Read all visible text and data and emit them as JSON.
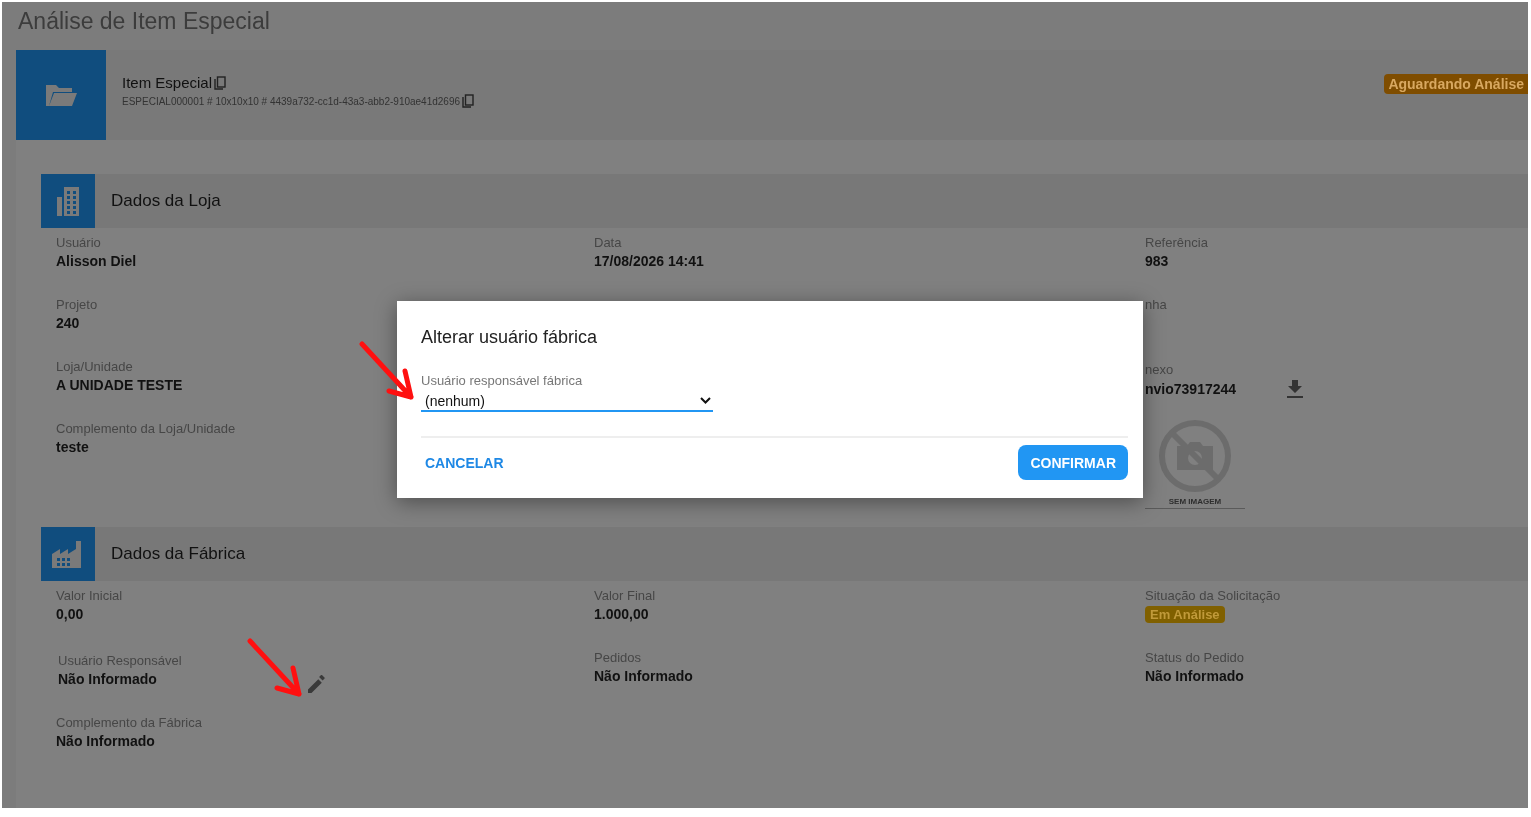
{
  "page": {
    "title": "Análise de Item Especial"
  },
  "item": {
    "title": "Item Especial",
    "code": "ESPECIAL000001 # 10x10x10 # 4439a732-cc1d-43a3-abb2-910ae41d2696",
    "status": "Aguardando Análise"
  },
  "sections": [
    {
      "kind": "store",
      "title": "Dados da Loja",
      "columns": [
        [
          {
            "kind": "text",
            "label": "Usuário",
            "value": "Alisson Diel"
          },
          {
            "kind": "text",
            "label": "Projeto",
            "value": "240"
          },
          {
            "kind": "text",
            "label": "Loja/Unidade",
            "value": "A UNIDADE TESTE"
          },
          {
            "kind": "text",
            "label": "Complemento da Loja/Unidade",
            "value": "teste"
          }
        ],
        [
          {
            "kind": "text",
            "label": "Data",
            "value": "17/08/2026 14:41"
          }
        ],
        [
          {
            "kind": "text",
            "label": "Referência",
            "value": "983"
          },
          {
            "kind": "text",
            "label": "nha"
          },
          {
            "kind": "attachment",
            "label": "nexo",
            "value": "nvio73917244"
          },
          {
            "kind": "image",
            "caption": "SEM IMAGEM"
          }
        ]
      ]
    },
    {
      "kind": "factory",
      "title": "Dados da Fábrica",
      "columns": [
        [
          {
            "kind": "text",
            "label": "Valor Inicial",
            "value": "0,00"
          },
          {
            "kind": "editable",
            "label": "Usuário Responsável",
            "value": "Não Informado"
          },
          {
            "kind": "text",
            "label": "Complemento da Fábrica",
            "value": "Não Informado"
          }
        ],
        [
          {
            "kind": "text",
            "label": "Valor Final",
            "value": "1.000,00"
          },
          {
            "kind": "text",
            "label": "Pedidos",
            "value": "Não Informado"
          }
        ],
        [
          {
            "kind": "badge",
            "label": "Situação da Solicitação",
            "value": "Em Análise"
          },
          {
            "kind": "text",
            "label": "Status do Pedido",
            "value": "Não Informado"
          }
        ]
      ]
    }
  ],
  "dialog": {
    "title": "Alterar usuário fábrica",
    "select": {
      "label": "Usuário responsável fábrica",
      "value": "(nenhum)"
    },
    "buttons": [
      {
        "kind": "text",
        "label": "CANCELAR"
      },
      {
        "kind": "primary",
        "label": "CONFIRMAR"
      }
    ]
  }
}
